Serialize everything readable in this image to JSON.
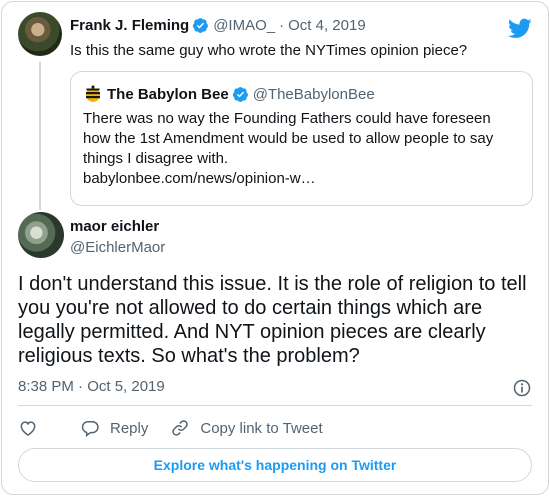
{
  "parent_tweet": {
    "author_name": "Frank J. Fleming",
    "handle": "@IMAO_",
    "separator": "·",
    "date": "Oct 4, 2019",
    "text": "Is this the same guy who wrote the NYTimes opinion piece?"
  },
  "quoted_tweet": {
    "author_name": "The Babylon Bee",
    "handle": "@TheBabylonBee",
    "text": "There was no way the Founding Fathers could have foreseen how the 1st Amendment would be used to allow people to say things I disagree with.",
    "link": "babylonbee.com/news/opinion-w…"
  },
  "main_tweet": {
    "author_name": "maor eichler",
    "handle": "@EichlerMaor",
    "text": "I don't understand this issue. It is the role of religion to tell you you're not allowed to do certain things which are legally permitted. And NYT opinion pieces are clearly religious texts. So what's the problem?",
    "timestamp": "8:38 PM · Oct 5, 2019"
  },
  "actions": {
    "like_icon": "heart-icon",
    "reply_label": "Reply",
    "copy_label": "Copy link to Tweet"
  },
  "footer": {
    "explore_label": "Explore what's happening on Twitter"
  },
  "colors": {
    "accent": "#1d9bf0",
    "secondary_text": "#536471",
    "border": "#cfd9de",
    "text": "#0f1419"
  }
}
